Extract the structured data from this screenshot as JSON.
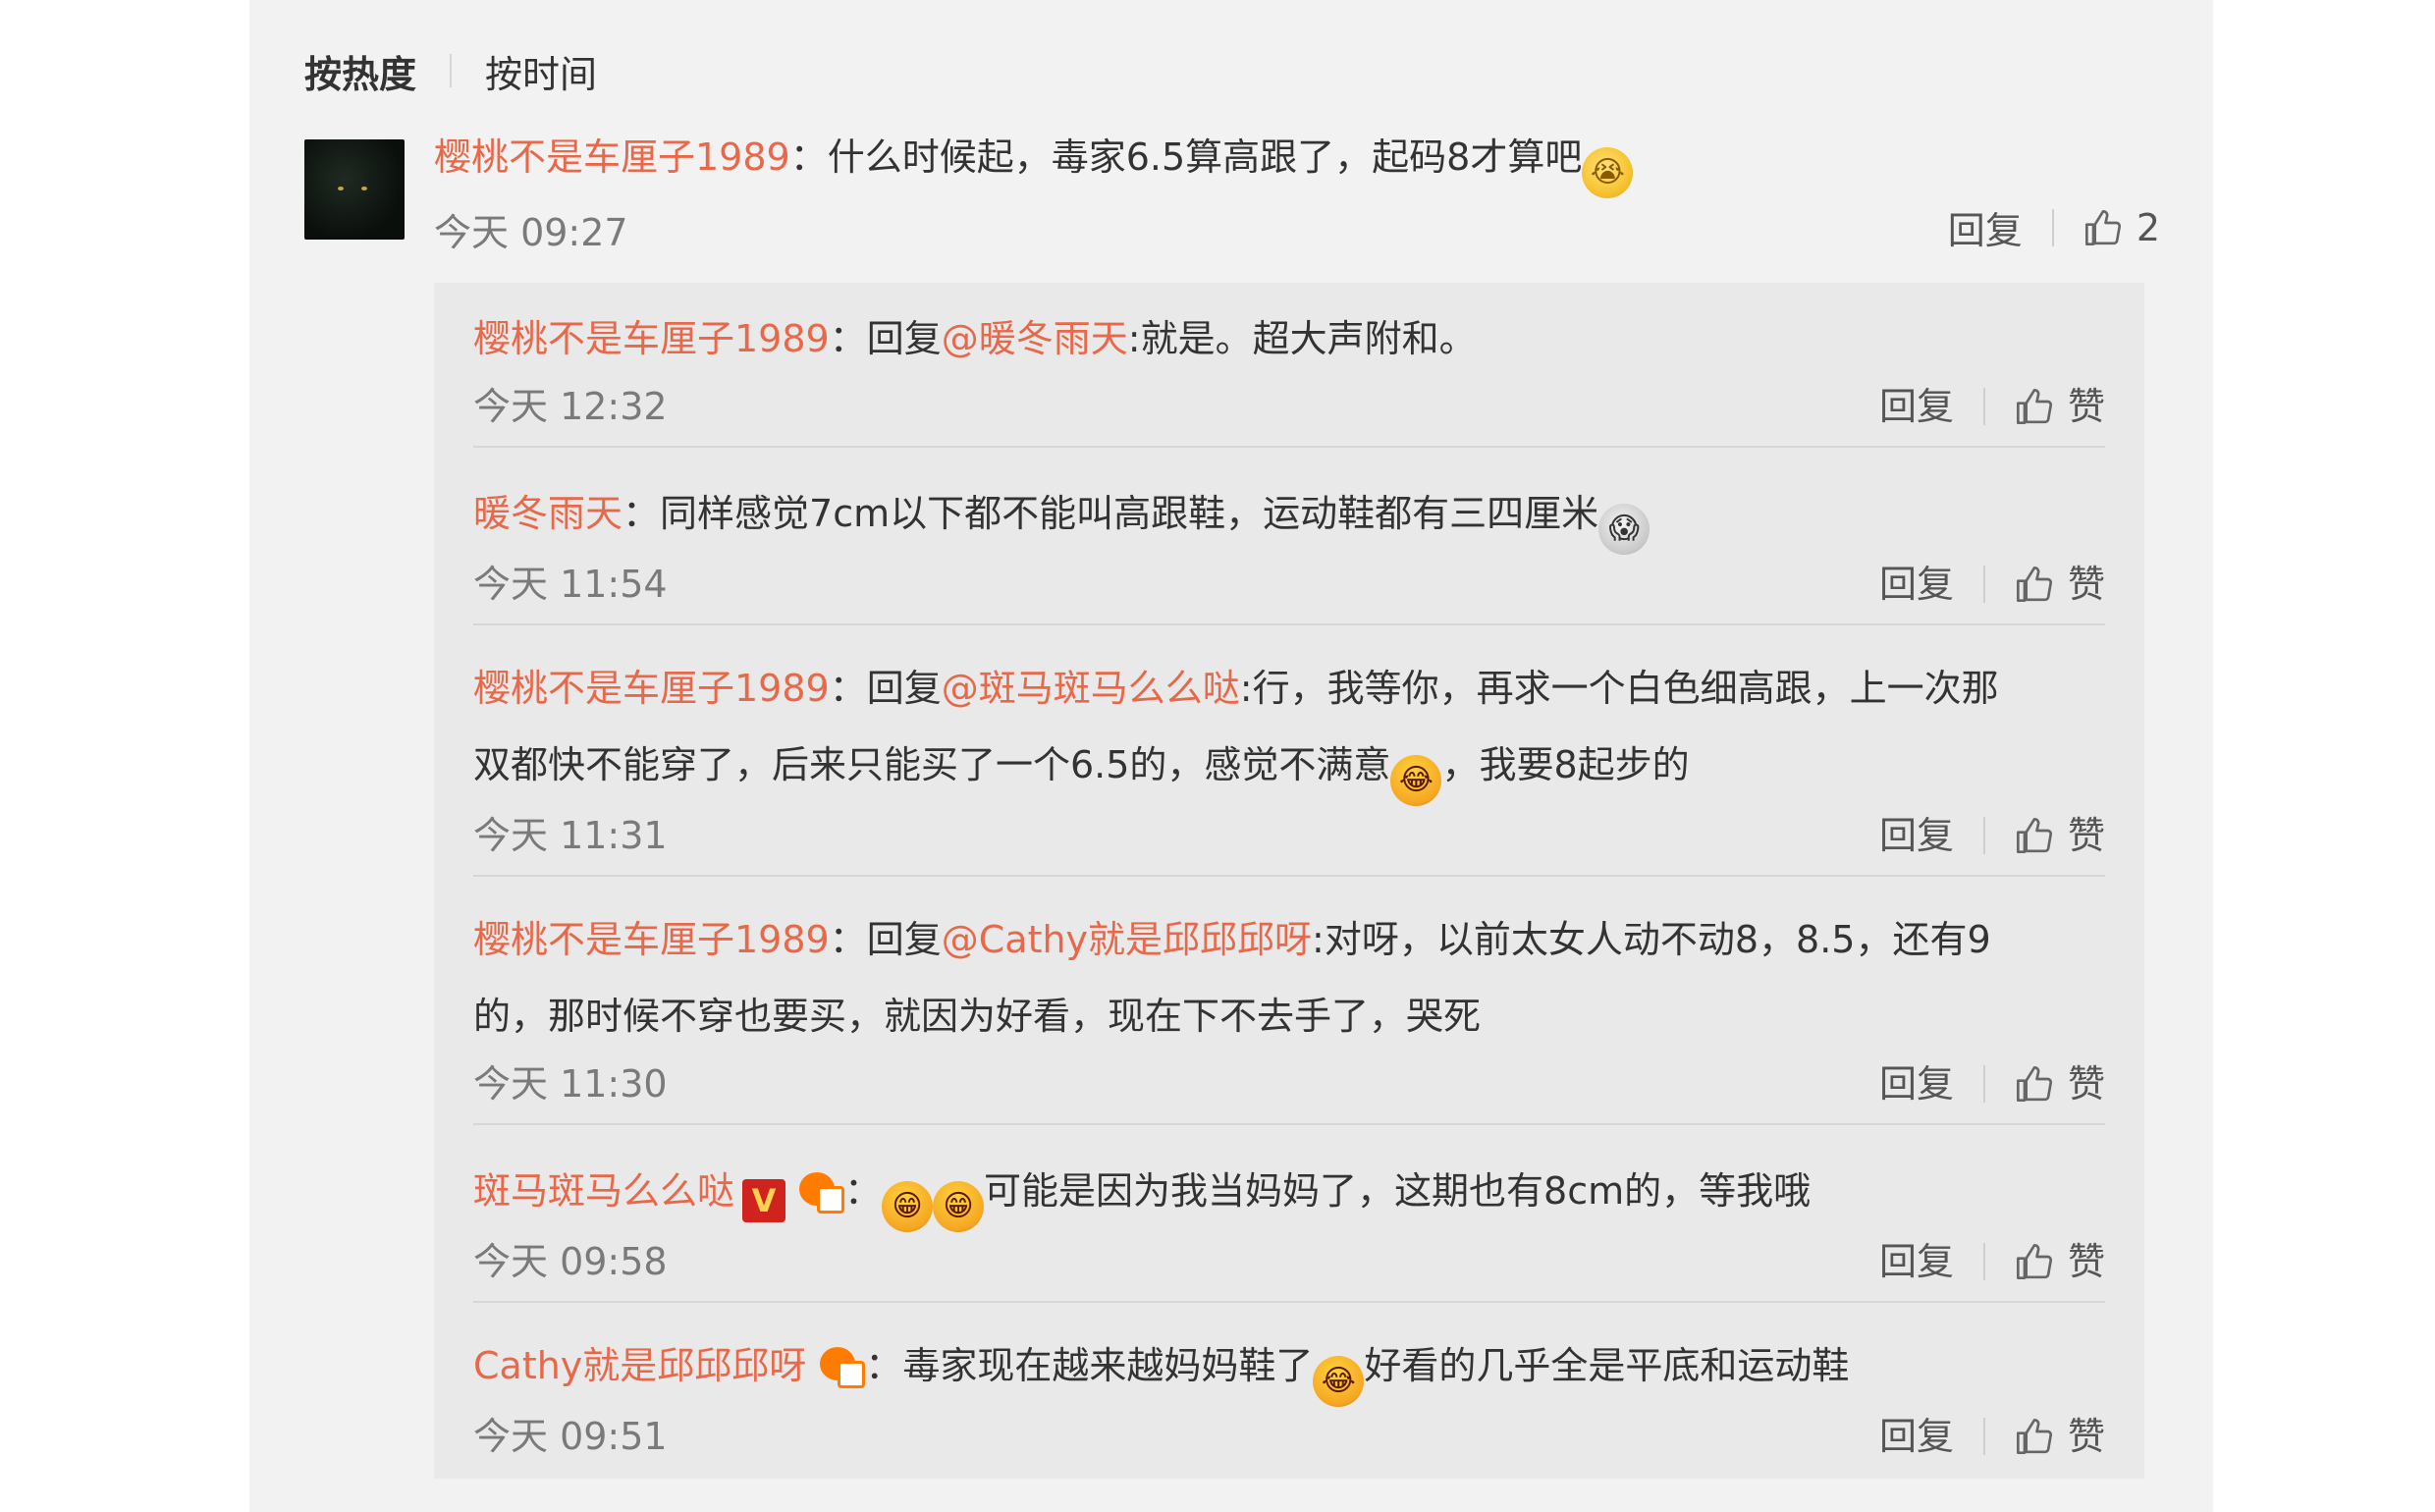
{
  "sort": {
    "hot": "按热度",
    "time": "按时间"
  },
  "main": {
    "user": "樱桃不是车厘子1989",
    "colon": "：",
    "text": "什么时候起，毒家6.5算高跟了，起码8才算吧",
    "emoji": "cry-emoji",
    "time": "今天 09:27",
    "reply": "回复",
    "like_count": "2"
  },
  "replies": [
    {
      "user": "樱桃不是车厘子1989",
      "colon": "：",
      "prefix": "回复",
      "mention": "@暖冬雨天",
      "text": ":就是。超大声附和。",
      "time": "今天 12:32",
      "reply": "回复",
      "like": "赞"
    },
    {
      "user": "暖冬雨天",
      "colon": "：",
      "text": "同样感觉7cm以下都不能叫高跟鞋，运动鞋都有三四厘米",
      "emoji": "shocked-emoji",
      "time": "今天 11:54",
      "reply": "回复",
      "like": "赞"
    },
    {
      "user": "樱桃不是车厘子1989",
      "colon": "：",
      "prefix": "回复",
      "mention": "@斑马斑马么么哒",
      "text1": ":行，我等你，再求一个白色细高跟，上一次那",
      "text2": "双都快不能穿了，后来只能买了一个6.5的，感觉不满意",
      "text3": "，我要8起步的",
      "emoji": "laughing-tears-emoji",
      "time": "今天 11:31",
      "reply": "回复",
      "like": "赞"
    },
    {
      "user": "樱桃不是车厘子1989",
      "colon": "：",
      "prefix": "回复",
      "mention": "@Cathy就是邱邱邱呀",
      "text1": ":对呀，以前太女人动不动8，8.5，还有9",
      "text2": "的，那时候不穿也要买，就因为好看，现在下不去手了，哭死",
      "time": "今天 11:30",
      "reply": "回复",
      "like": "赞"
    },
    {
      "user": "斑马斑马么么哒",
      "badge": "V",
      "colon": "：",
      "text": "可能是因为我当妈妈了，这期也有8cm的，等我哦",
      "time": "今天 09:58",
      "reply": "回复",
      "like": "赞"
    },
    {
      "user": "Cathy就是邱邱邱呀",
      "colon": "：",
      "text1": "毒家现在越来越妈妈鞋了",
      "text2": "好看的几乎全是平底和运动鞋",
      "time": "今天 09:51",
      "reply": "回复",
      "like": "赞"
    }
  ],
  "colors": {
    "username": "#e8684a",
    "panel": "#f2f2f2",
    "reply_panel": "#e9e9e9",
    "meta": "#7a7a7a"
  }
}
